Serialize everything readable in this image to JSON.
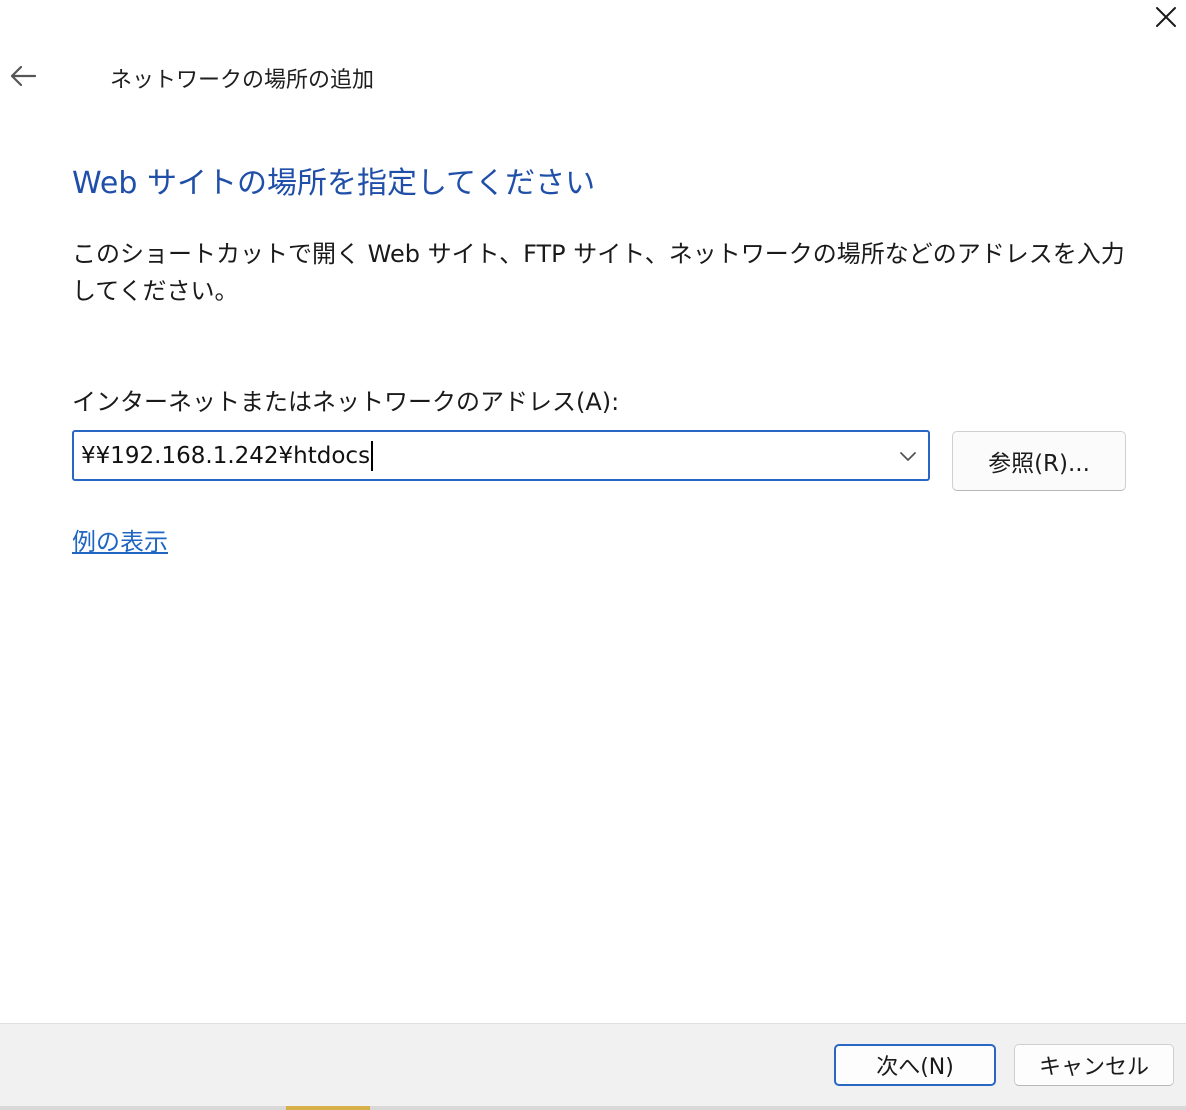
{
  "window": {
    "title": "ネットワークの場所の追加"
  },
  "icons": {
    "close": "close-icon",
    "back": "back-arrow-icon",
    "dropdown": "chevron-down-icon"
  },
  "colors": {
    "heading": "#1f4fa8",
    "link": "#1f66c2",
    "focus_border": "#2a67c5",
    "footer_bg": "#f1f1f1"
  },
  "main": {
    "heading": "Web サイトの場所を指定してください",
    "description": "このショートカットで開く Web サイト、FTP サイト、ネットワークの場所などのアドレスを入力してください。",
    "address_label": "インターネットまたはネットワークのアドレス(A):",
    "address_value": "¥¥192.168.1.242¥htdocs",
    "browse_label": "参照(R)...",
    "examples_link": "例の表示"
  },
  "footer": {
    "next_label": "次へ(N)",
    "cancel_label": "キャンセル"
  }
}
